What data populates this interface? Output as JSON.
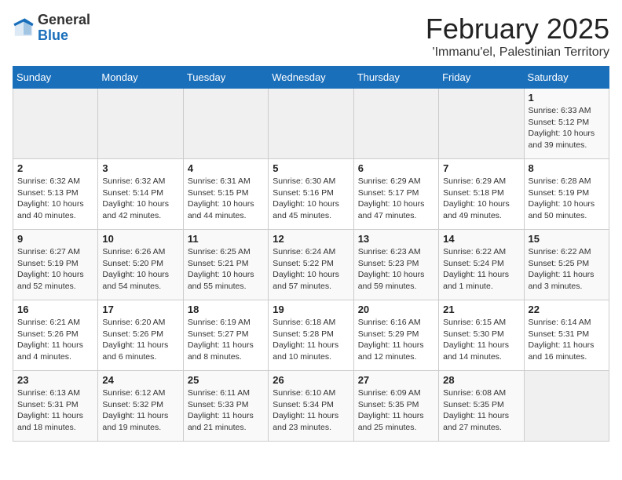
{
  "header": {
    "logo": {
      "general": "General",
      "blue": "Blue"
    },
    "title": "February 2025",
    "subtitle": "'Immanu'el, Palestinian Territory"
  },
  "days_of_week": [
    "Sunday",
    "Monday",
    "Tuesday",
    "Wednesday",
    "Thursday",
    "Friday",
    "Saturday"
  ],
  "weeks": [
    [
      {
        "day": "",
        "info": ""
      },
      {
        "day": "",
        "info": ""
      },
      {
        "day": "",
        "info": ""
      },
      {
        "day": "",
        "info": ""
      },
      {
        "day": "",
        "info": ""
      },
      {
        "day": "",
        "info": ""
      },
      {
        "day": "1",
        "info": "Sunrise: 6:33 AM\nSunset: 5:12 PM\nDaylight: 10 hours and 39 minutes."
      }
    ],
    [
      {
        "day": "2",
        "info": "Sunrise: 6:32 AM\nSunset: 5:13 PM\nDaylight: 10 hours and 40 minutes."
      },
      {
        "day": "3",
        "info": "Sunrise: 6:32 AM\nSunset: 5:14 PM\nDaylight: 10 hours and 42 minutes."
      },
      {
        "day": "4",
        "info": "Sunrise: 6:31 AM\nSunset: 5:15 PM\nDaylight: 10 hours and 44 minutes."
      },
      {
        "day": "5",
        "info": "Sunrise: 6:30 AM\nSunset: 5:16 PM\nDaylight: 10 hours and 45 minutes."
      },
      {
        "day": "6",
        "info": "Sunrise: 6:29 AM\nSunset: 5:17 PM\nDaylight: 10 hours and 47 minutes."
      },
      {
        "day": "7",
        "info": "Sunrise: 6:29 AM\nSunset: 5:18 PM\nDaylight: 10 hours and 49 minutes."
      },
      {
        "day": "8",
        "info": "Sunrise: 6:28 AM\nSunset: 5:19 PM\nDaylight: 10 hours and 50 minutes."
      }
    ],
    [
      {
        "day": "9",
        "info": "Sunrise: 6:27 AM\nSunset: 5:19 PM\nDaylight: 10 hours and 52 minutes."
      },
      {
        "day": "10",
        "info": "Sunrise: 6:26 AM\nSunset: 5:20 PM\nDaylight: 10 hours and 54 minutes."
      },
      {
        "day": "11",
        "info": "Sunrise: 6:25 AM\nSunset: 5:21 PM\nDaylight: 10 hours and 55 minutes."
      },
      {
        "day": "12",
        "info": "Sunrise: 6:24 AM\nSunset: 5:22 PM\nDaylight: 10 hours and 57 minutes."
      },
      {
        "day": "13",
        "info": "Sunrise: 6:23 AM\nSunset: 5:23 PM\nDaylight: 10 hours and 59 minutes."
      },
      {
        "day": "14",
        "info": "Sunrise: 6:22 AM\nSunset: 5:24 PM\nDaylight: 11 hours and 1 minute."
      },
      {
        "day": "15",
        "info": "Sunrise: 6:22 AM\nSunset: 5:25 PM\nDaylight: 11 hours and 3 minutes."
      }
    ],
    [
      {
        "day": "16",
        "info": "Sunrise: 6:21 AM\nSunset: 5:26 PM\nDaylight: 11 hours and 4 minutes."
      },
      {
        "day": "17",
        "info": "Sunrise: 6:20 AM\nSunset: 5:26 PM\nDaylight: 11 hours and 6 minutes."
      },
      {
        "day": "18",
        "info": "Sunrise: 6:19 AM\nSunset: 5:27 PM\nDaylight: 11 hours and 8 minutes."
      },
      {
        "day": "19",
        "info": "Sunrise: 6:18 AM\nSunset: 5:28 PM\nDaylight: 11 hours and 10 minutes."
      },
      {
        "day": "20",
        "info": "Sunrise: 6:16 AM\nSunset: 5:29 PM\nDaylight: 11 hours and 12 minutes."
      },
      {
        "day": "21",
        "info": "Sunrise: 6:15 AM\nSunset: 5:30 PM\nDaylight: 11 hours and 14 minutes."
      },
      {
        "day": "22",
        "info": "Sunrise: 6:14 AM\nSunset: 5:31 PM\nDaylight: 11 hours and 16 minutes."
      }
    ],
    [
      {
        "day": "23",
        "info": "Sunrise: 6:13 AM\nSunset: 5:31 PM\nDaylight: 11 hours and 18 minutes."
      },
      {
        "day": "24",
        "info": "Sunrise: 6:12 AM\nSunset: 5:32 PM\nDaylight: 11 hours and 19 minutes."
      },
      {
        "day": "25",
        "info": "Sunrise: 6:11 AM\nSunset: 5:33 PM\nDaylight: 11 hours and 21 minutes."
      },
      {
        "day": "26",
        "info": "Sunrise: 6:10 AM\nSunset: 5:34 PM\nDaylight: 11 hours and 23 minutes."
      },
      {
        "day": "27",
        "info": "Sunrise: 6:09 AM\nSunset: 5:35 PM\nDaylight: 11 hours and 25 minutes."
      },
      {
        "day": "28",
        "info": "Sunrise: 6:08 AM\nSunset: 5:35 PM\nDaylight: 11 hours and 27 minutes."
      },
      {
        "day": "",
        "info": ""
      }
    ]
  ]
}
